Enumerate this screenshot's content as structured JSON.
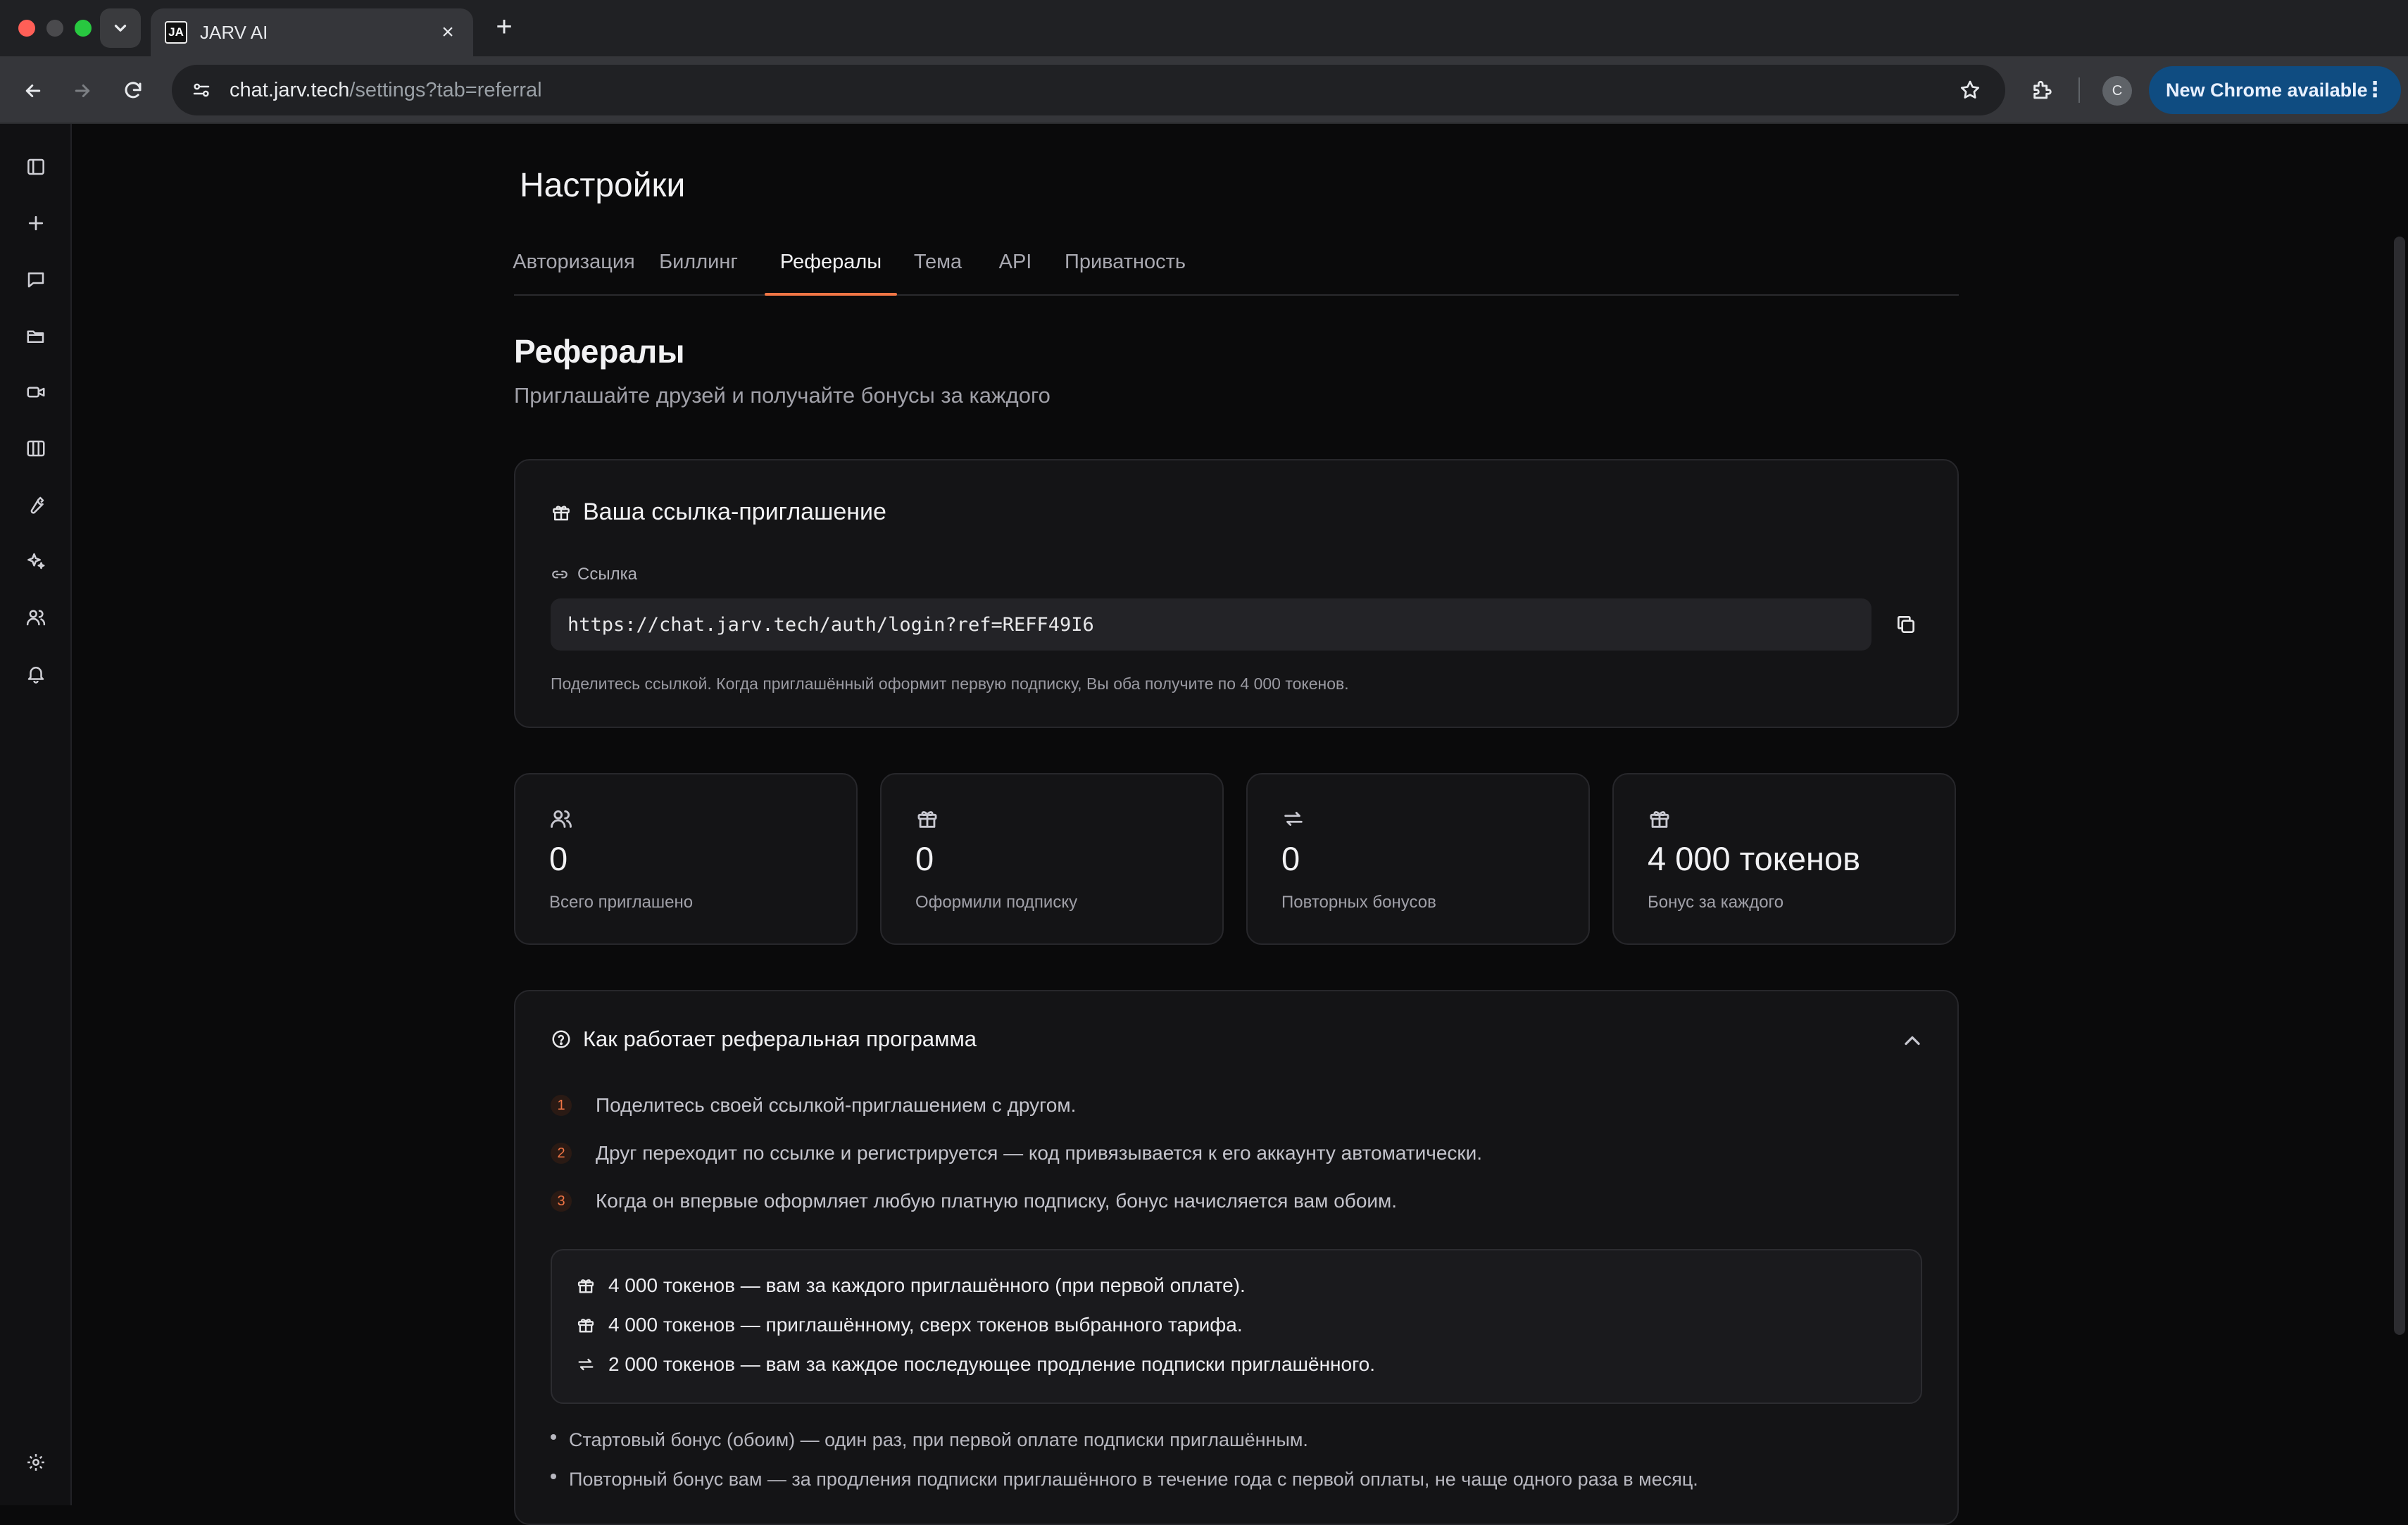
{
  "browser": {
    "tab_title": "JARV AI",
    "tab_favicon": "JA",
    "url_host": "chat.jarv.tech",
    "url_path": "/settings?tab=referral",
    "profile_initial": "C",
    "update_label": "New Chrome available"
  },
  "sidebar": {
    "icons": [
      "sidebar-toggle-icon",
      "plus-icon",
      "chat-icon",
      "folder-icon",
      "video-icon",
      "columns-icon",
      "wrench-icon",
      "sparkles-icon",
      "users-icon",
      "bell-icon",
      "gear-icon"
    ]
  },
  "settings": {
    "title": "Настройки",
    "tabs": [
      {
        "label": "Авторизация"
      },
      {
        "label": "Биллинг"
      },
      {
        "label": "Рефералы"
      },
      {
        "label": "Тема"
      },
      {
        "label": "API"
      },
      {
        "label": "Приватность"
      }
    ],
    "active_tab": "Рефералы"
  },
  "referral": {
    "title": "Рефералы",
    "subtitle": "Приглашайте друзей и получайте бонусы за каждого",
    "invite": {
      "title": "Ваша ссылка-приглашение",
      "field_label": "Ссылка",
      "link": "https://chat.jarv.tech/auth/login?ref=REFF49I6",
      "hint": "Поделитесь ссылкой. Когда приглашённый оформит первую подписку, Вы оба получите по 4 000 токенов."
    },
    "stats": [
      {
        "icon": "users-icon",
        "value": "0",
        "label": "Всего приглашено"
      },
      {
        "icon": "gift-icon",
        "value": "0",
        "label": "Оформили подписку"
      },
      {
        "icon": "repeat-icon",
        "value": "0",
        "label": "Повторных бонусов"
      },
      {
        "icon": "gift-icon",
        "value": "4 000 токенов",
        "label": "Бонус за каждого"
      }
    ],
    "how": {
      "title": "Как работает реферальная программа",
      "steps": [
        {
          "num": "1",
          "text": "Поделитесь своей ссылкой-приглашением с другом."
        },
        {
          "num": "2",
          "text": "Друг переходит по ссылке и регистрируется — код привязывается к его аккаунту автоматически."
        },
        {
          "num": "3",
          "text": "Когда он впервые оформляет любую платную подписку, бонус начисляется вам обоим."
        }
      ],
      "bonuses": [
        {
          "icon": "gift-icon",
          "text": "4 000 токенов — вам за каждого приглашённого (при первой оплате)."
        },
        {
          "icon": "gift-icon",
          "text": "4 000 токенов — приглашённому, сверх токенов выбранного тарифа."
        },
        {
          "icon": "repeat-icon",
          "text": "2 000 токенов — вам за каждое последующее продление подписки приглашённого."
        }
      ],
      "notes": [
        "Стартовый бонус (обоим) — один раз, при первой оплате подписки приглашённым.",
        "Повторный бонус вам — за продления подписки приглашённого в течение года с первой оплаты, не чаще одного раза в месяц."
      ]
    }
  },
  "colors": {
    "accent": "#f07545",
    "background": "#0a0a0b",
    "card": "#141416"
  }
}
